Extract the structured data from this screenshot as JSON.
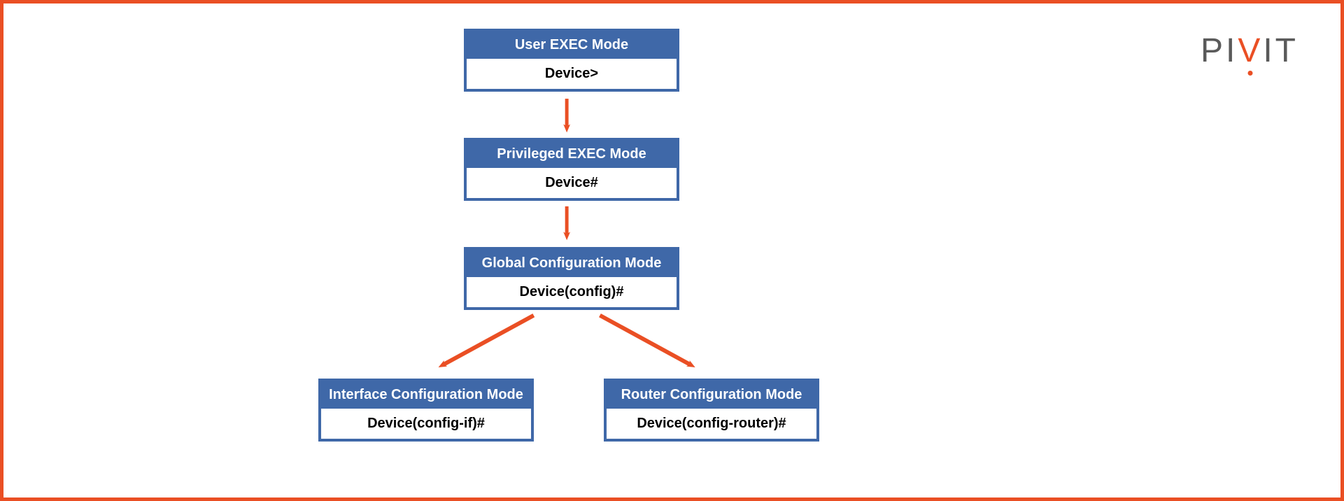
{
  "logo": {
    "text_before_v": "PI",
    "v": "V",
    "text_after_v": "IT"
  },
  "nodes": {
    "user_exec": {
      "title": "User EXEC Mode",
      "prompt": "Device>"
    },
    "priv_exec": {
      "title": "Privileged EXEC Mode",
      "prompt": "Device#"
    },
    "global_config": {
      "title": "Global Configuration Mode",
      "prompt": "Device(config)#"
    },
    "if_config": {
      "title": "Interface Configuration Mode",
      "prompt": "Device(config-if)#"
    },
    "router_config": {
      "title": "Router Configuration Mode",
      "prompt": "Device(config-router)#"
    }
  },
  "colors": {
    "border": "#ea4f24",
    "arrow": "#ea4f24",
    "node_header": "#3f68a8"
  }
}
